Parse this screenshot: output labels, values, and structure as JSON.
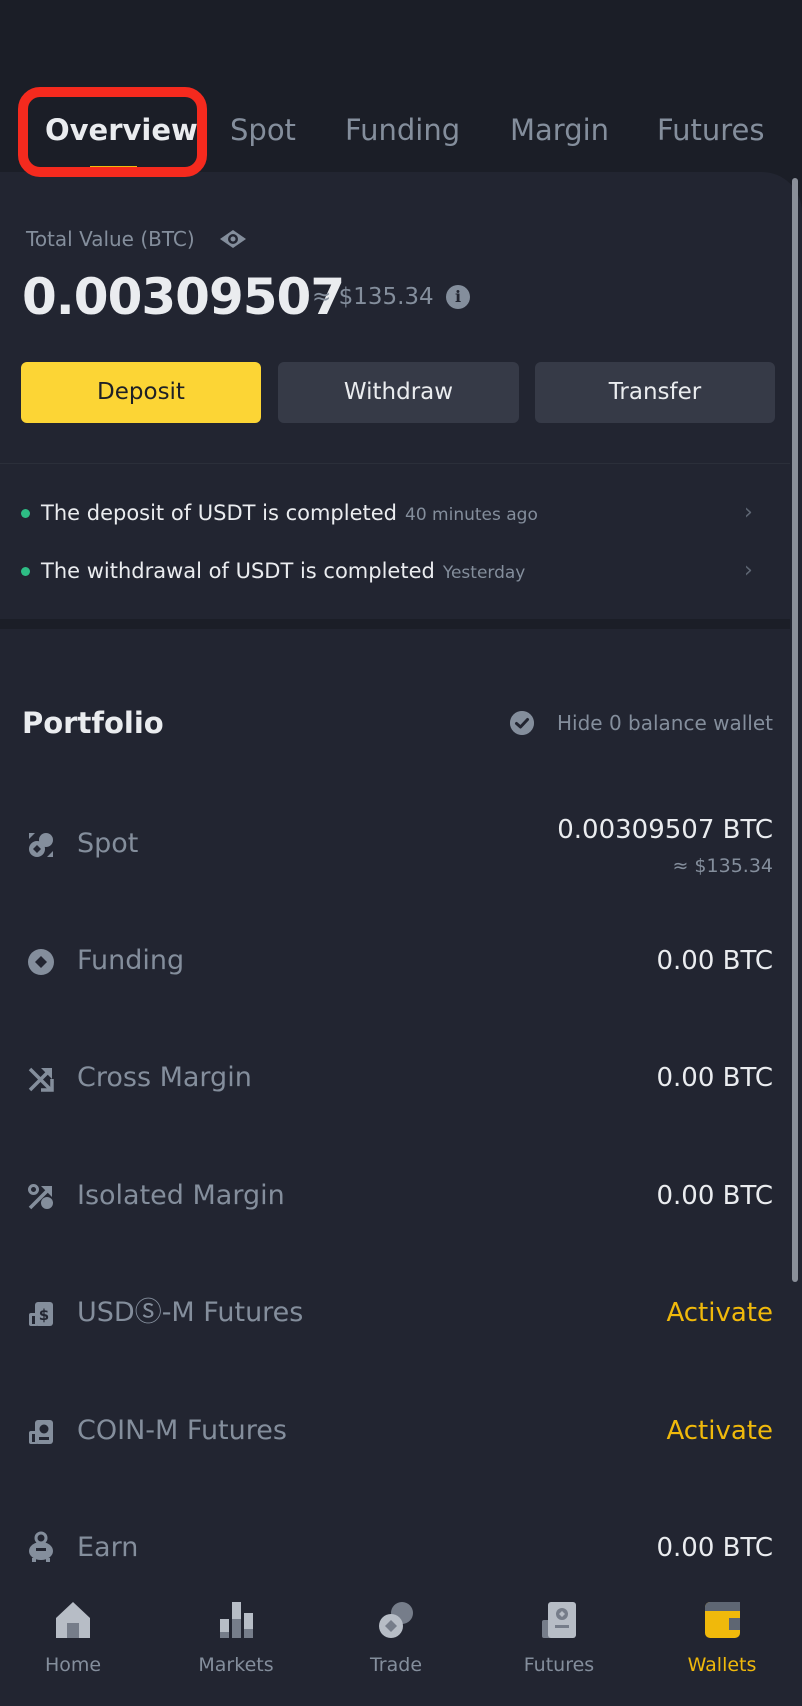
{
  "tabs": [
    {
      "label": "Overview",
      "active": true
    },
    {
      "label": "Spot",
      "active": false
    },
    {
      "label": "Funding",
      "active": false
    },
    {
      "label": "Margin",
      "active": false
    },
    {
      "label": "Futures",
      "active": false
    }
  ],
  "summary": {
    "total_label": "Total Value (BTC)",
    "total_value": "0.00309507",
    "approx_usd": "≈ $135.34",
    "eye_icon": "eye-icon",
    "info_icon": "info-icon"
  },
  "actions": {
    "deposit": "Deposit",
    "withdraw": "Withdraw",
    "transfer": "Transfer"
  },
  "notices": [
    {
      "message": "The deposit of USDT is completed",
      "time": "40 minutes ago",
      "status_color": "#2ebd85"
    },
    {
      "message": "The withdrawal of USDT is completed",
      "time": "Yesterday",
      "status_color": "#2ebd85"
    }
  ],
  "portfolio": {
    "title": "Portfolio",
    "hide_zero_label": "Hide 0 balance wallet",
    "hide_zero_checked": true,
    "wallets": [
      {
        "name": "Spot",
        "icon": "spot-icon",
        "value": "0.00309507 BTC",
        "sub": "≈ $135.34"
      },
      {
        "name": "Funding",
        "icon": "funding-icon",
        "value": "0.00 BTC"
      },
      {
        "name": "Cross Margin",
        "icon": "cross-margin-icon",
        "value": "0.00 BTC"
      },
      {
        "name": "Isolated Margin",
        "icon": "isolated-margin-icon",
        "value": "0.00 BTC"
      },
      {
        "name": "USDⓈ-M Futures",
        "icon": "usds-m-futures-icon",
        "value": "Activate"
      },
      {
        "name": "COIN-M Futures",
        "icon": "coin-m-futures-icon",
        "value": "Activate"
      },
      {
        "name": "Earn",
        "icon": "earn-icon",
        "value": "0.00 BTC"
      }
    ]
  },
  "nav": [
    {
      "label": "Home",
      "icon": "home-icon",
      "active": false
    },
    {
      "label": "Markets",
      "icon": "markets-icon",
      "active": false
    },
    {
      "label": "Trade",
      "icon": "trade-icon",
      "active": false
    },
    {
      "label": "Futures",
      "icon": "futures-icon",
      "active": false
    },
    {
      "label": "Wallets",
      "icon": "wallets-icon",
      "active": true
    }
  ],
  "colors": {
    "accent": "#f0b90b",
    "deposit_button": "#fcd535",
    "success": "#2ebd85",
    "annotation_box": "#f52a1e"
  }
}
